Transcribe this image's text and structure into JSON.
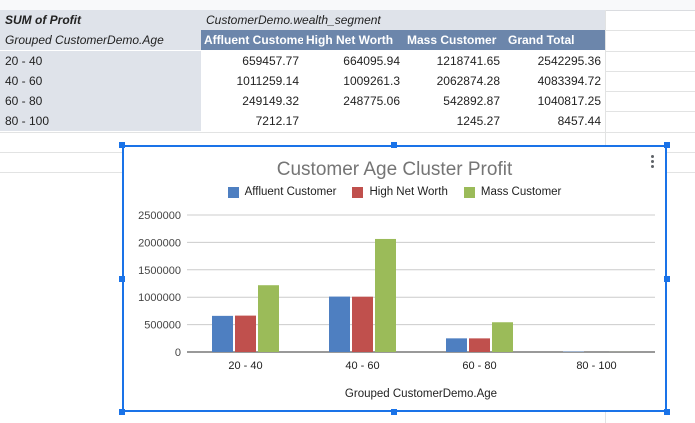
{
  "pivot": {
    "corner_title": "SUM of Profit",
    "row_group_label": "Grouped CustomerDemo.Age",
    "column_group_label": "CustomerDemo.wealth_segment",
    "columns": [
      "Affluent Customer",
      "High Net Worth",
      "Mass Customer",
      "Grand Total"
    ],
    "rows": [
      {
        "label": "20 - 40",
        "values": [
          "659457.77",
          "664095.94",
          "1218741.65",
          "2542295.36"
        ]
      },
      {
        "label": "40 - 60",
        "values": [
          "1011259.14",
          "1009261.3",
          "2062874.28",
          "4083394.72"
        ]
      },
      {
        "label": "60 - 80",
        "values": [
          "249149.32",
          "248775.06",
          "542892.87",
          "1040817.25"
        ]
      },
      {
        "label": "80 - 100",
        "values": [
          "7212.17",
          "",
          "1245.27",
          "8457.44"
        ]
      }
    ]
  },
  "chart_data": {
    "type": "bar",
    "title": "Customer Age Cluster Profit",
    "xlabel": "Grouped CustomerDemo.Age",
    "ylabel": "",
    "categories": [
      "20 - 40",
      "40 - 60",
      "60 - 80",
      "80 - 100"
    ],
    "series": [
      {
        "name": "Affluent Customer",
        "color": "#4e7fc1",
        "values": [
          659457.77,
          1011259.14,
          249149.32,
          7212.17
        ]
      },
      {
        "name": "High Net Worth",
        "color": "#c0504d",
        "values": [
          664095.94,
          1009261.3,
          248775.06,
          0
        ]
      },
      {
        "name": "Mass Customer",
        "color": "#9bbb59",
        "values": [
          1218741.65,
          2062874.28,
          542892.87,
          1245.27
        ]
      }
    ],
    "yticks": [
      "0",
      "500000",
      "1000000",
      "1500000",
      "2000000",
      "2500000"
    ],
    "ylim": [
      0,
      2500000
    ],
    "legend_position": "top",
    "grid": true
  }
}
